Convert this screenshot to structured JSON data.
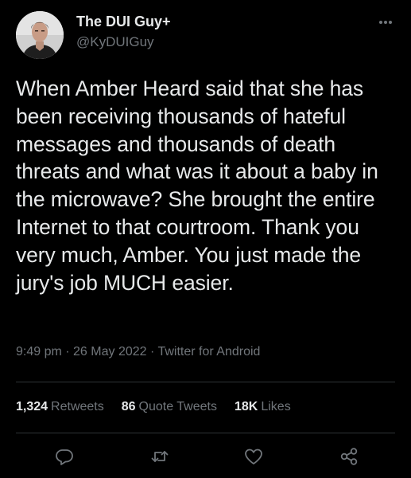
{
  "author": {
    "display_name": "The DUI Guy+",
    "handle": "@KyDUIGuy",
    "avatar_icon": "profile-photo"
  },
  "tweet": {
    "text": "When Amber Heard said that she has been receiving thousands of hateful messages and thousands of death threats and what was it about a baby in the microwave? She brought the entire Internet to that courtroom. Thank you very much, Amber. You just made the jury's job MUCH easier."
  },
  "meta": {
    "time": "9:49 pm",
    "sep1": " · ",
    "date": "26 May 2022",
    "sep2": " · ",
    "source": "Twitter for Android"
  },
  "stats": {
    "retweets_count": "1,324",
    "retweets_label": "Retweets",
    "quotes_count": "86",
    "quotes_label": "Quote Tweets",
    "likes_count": "18K",
    "likes_label": "Likes"
  },
  "actions": [
    "reply-icon",
    "retweet-icon",
    "like-icon",
    "share-icon"
  ],
  "colors": {
    "background": "#000000",
    "text_primary": "#e7e9ea",
    "text_secondary": "#71767b",
    "divider": "#2f3336"
  }
}
